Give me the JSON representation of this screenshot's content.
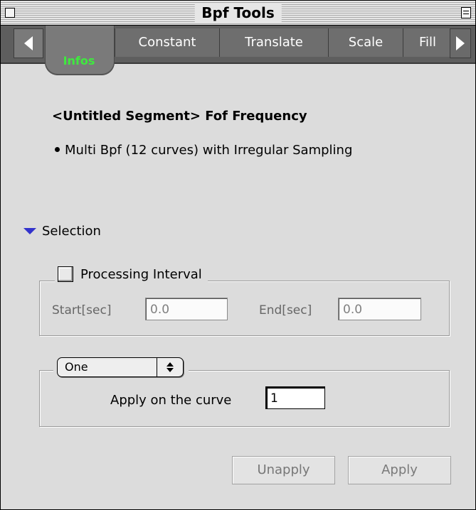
{
  "window": {
    "title": "Bpf Tools"
  },
  "tabs": [
    {
      "label": "Infos",
      "active": true
    },
    {
      "label": "Constant",
      "active": false
    },
    {
      "label": "Translate",
      "active": false
    },
    {
      "label": "Scale",
      "active": false
    },
    {
      "label": "Fill",
      "active": false
    }
  ],
  "info": {
    "segment_title": "<Untitled Segment> Fof Frequency",
    "description": "Multi Bpf (12 curves) with Irregular Sampling"
  },
  "selection": {
    "label": "Selection",
    "processing_interval": {
      "label": "Processing Interval",
      "checked": false,
      "start_label": "Start[sec]",
      "start_value": "0.0",
      "end_label": "End[sec]",
      "end_value": "0.0"
    },
    "curve_mode": {
      "selected": "One",
      "apply_label": "Apply on the curve",
      "curve_value": "1"
    }
  },
  "buttons": {
    "unapply": "Unapply",
    "apply": "Apply"
  },
  "colors": {
    "active_tab_text": "#3eea3e",
    "disclosure_triangle": "#3333cc",
    "tab_bar": "#5e5e5e",
    "window_bg": "#dcdcdc"
  }
}
